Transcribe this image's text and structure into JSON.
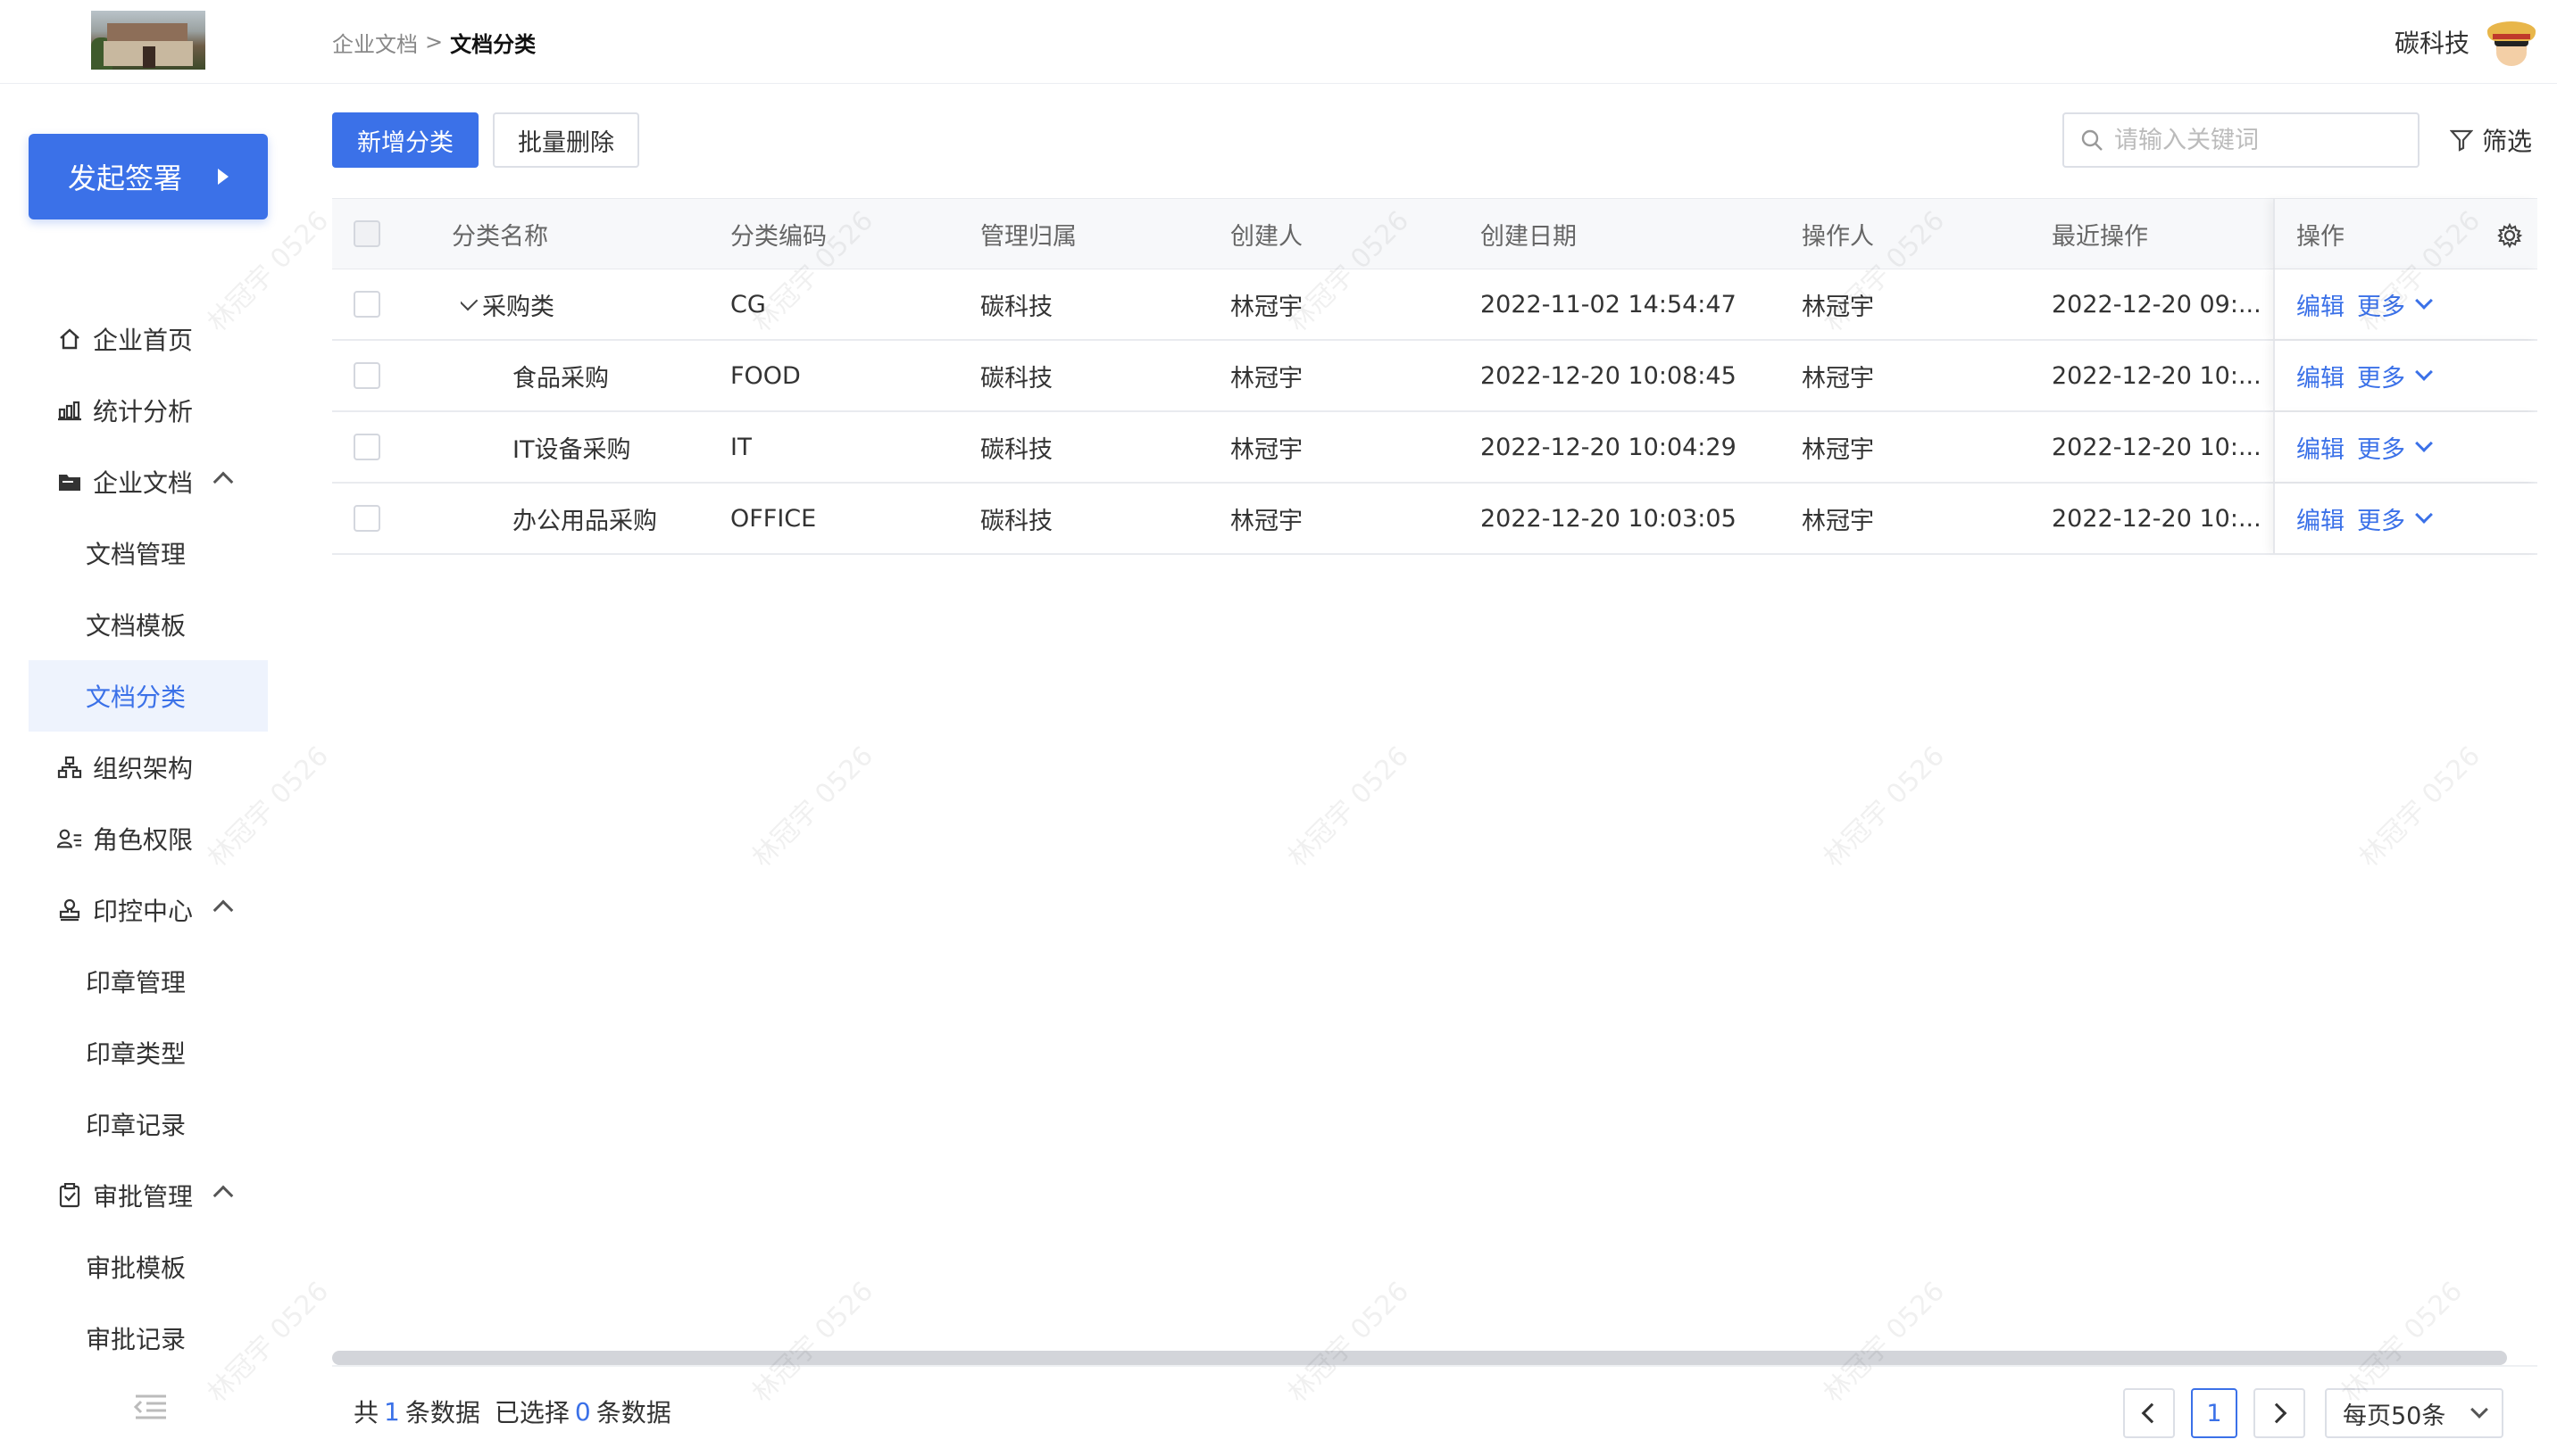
{
  "header": {
    "breadcrumb": [
      "企业文档",
      ">",
      "文档分类"
    ],
    "user_name": "碳科技"
  },
  "sidebar": {
    "cta_label": "发起签署",
    "items": [
      {
        "label": "企业首页",
        "level": "top",
        "icon": "home-icon"
      },
      {
        "label": "统计分析",
        "level": "top",
        "icon": "bar-chart-icon"
      },
      {
        "label": "企业文档",
        "level": "top",
        "icon": "folder-icon",
        "expanded": true
      },
      {
        "label": "文档管理",
        "level": "sub"
      },
      {
        "label": "文档模板",
        "level": "sub"
      },
      {
        "label": "文档分类",
        "level": "sub",
        "active": true
      },
      {
        "label": "组织架构",
        "level": "top",
        "icon": "org-chart-icon"
      },
      {
        "label": "角色权限",
        "level": "top",
        "icon": "user-role-icon"
      },
      {
        "label": "印控中心",
        "level": "top",
        "icon": "stamp-icon",
        "expanded": true
      },
      {
        "label": "印章管理",
        "level": "sub"
      },
      {
        "label": "印章类型",
        "level": "sub"
      },
      {
        "label": "印章记录",
        "level": "sub"
      },
      {
        "label": "审批管理",
        "level": "top",
        "icon": "clipboard-icon",
        "expanded": true
      },
      {
        "label": "审批模板",
        "level": "sub"
      },
      {
        "label": "审批记录",
        "level": "sub"
      }
    ]
  },
  "toolbar": {
    "add_label": "新增分类",
    "batch_delete_label": "批量删除",
    "search_placeholder": "请输入关键词",
    "filter_label": "筛选"
  },
  "table": {
    "columns": [
      "分类名称",
      "分类编码",
      "管理归属",
      "创建人",
      "创建日期",
      "操作人",
      "最近操作",
      "操作"
    ],
    "rows": [
      {
        "name": "采购类",
        "code": "CG",
        "owner": "碳科技",
        "creator": "林冠宇",
        "created": "2022-11-02 14:54:47",
        "operator": "林冠宇",
        "last_op": "2022-12-20 09:...",
        "parent": true
      },
      {
        "name": "食品采购",
        "code": "FOOD",
        "owner": "碳科技",
        "creator": "林冠宇",
        "created": "2022-12-20 10:08:45",
        "operator": "林冠宇",
        "last_op": "2022-12-20 10:..."
      },
      {
        "name": "IT设备采购",
        "code": "IT",
        "owner": "碳科技",
        "creator": "林冠宇",
        "created": "2022-12-20 10:04:29",
        "operator": "林冠宇",
        "last_op": "2022-12-20 10:..."
      },
      {
        "name": "办公用品采购",
        "code": "OFFICE",
        "owner": "碳科技",
        "creator": "林冠宇",
        "created": "2022-12-20 10:03:05",
        "operator": "林冠宇",
        "last_op": "2022-12-20 10:..."
      }
    ],
    "edit_label": "编辑",
    "more_label": "更多"
  },
  "footer": {
    "total_prefix": "共",
    "total_count": "1",
    "total_suffix": "条数据",
    "selected_prefix": "已选择",
    "selected_count": "0",
    "selected_suffix": "条数据",
    "current_page": "1",
    "page_size": "每页50条"
  },
  "watermark": "林冠宇 0526",
  "colors": {
    "accent": "#3b71e8"
  }
}
